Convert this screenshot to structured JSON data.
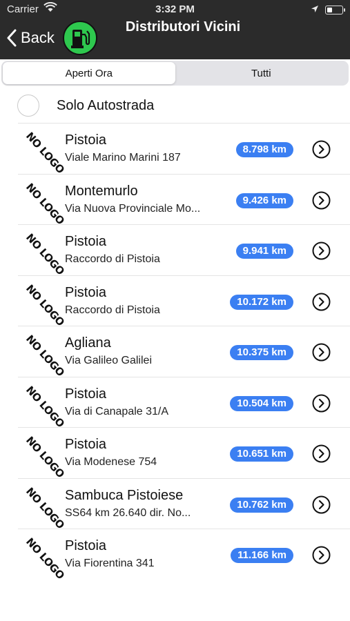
{
  "status_bar": {
    "carrier": "Carrier",
    "time": "3:32 PM"
  },
  "nav": {
    "back_label": "Back",
    "title": "Distributori Vicini",
    "accent": "#2ec84e"
  },
  "segments": {
    "open_now": "Aperti Ora",
    "all": "Tutti",
    "selected": "Aperti Ora"
  },
  "filter": {
    "label": "Solo Autostrada",
    "checked": false
  },
  "logo_text": "NO LOGO",
  "badge_color": "#3b7ff2",
  "stations": [
    {
      "city": "Pistoia",
      "address": "Viale Marino Marini 187",
      "distance": "8.798 km"
    },
    {
      "city": "Montemurlo",
      "address": "Via Nuova Provinciale Mo...",
      "distance": "9.426 km"
    },
    {
      "city": "Pistoia",
      "address": "Raccordo di Pistoia",
      "distance": "9.941 km"
    },
    {
      "city": "Pistoia",
      "address": "Raccordo di Pistoia",
      "distance": "10.172 km"
    },
    {
      "city": "Agliana",
      "address": "Via Galileo Galilei",
      "distance": "10.375 km"
    },
    {
      "city": "Pistoia",
      "address": "Via di Canapale 31/A",
      "distance": "10.504 km"
    },
    {
      "city": "Pistoia",
      "address": "Via Modenese 754",
      "distance": "10.651 km"
    },
    {
      "city": "Sambuca Pistoiese",
      "address": "SS64 km 26.640 dir. No...",
      "distance": "10.762 km"
    },
    {
      "city": "Pistoia",
      "address": "Via Fiorentina 341",
      "distance": "11.166 km"
    }
  ]
}
